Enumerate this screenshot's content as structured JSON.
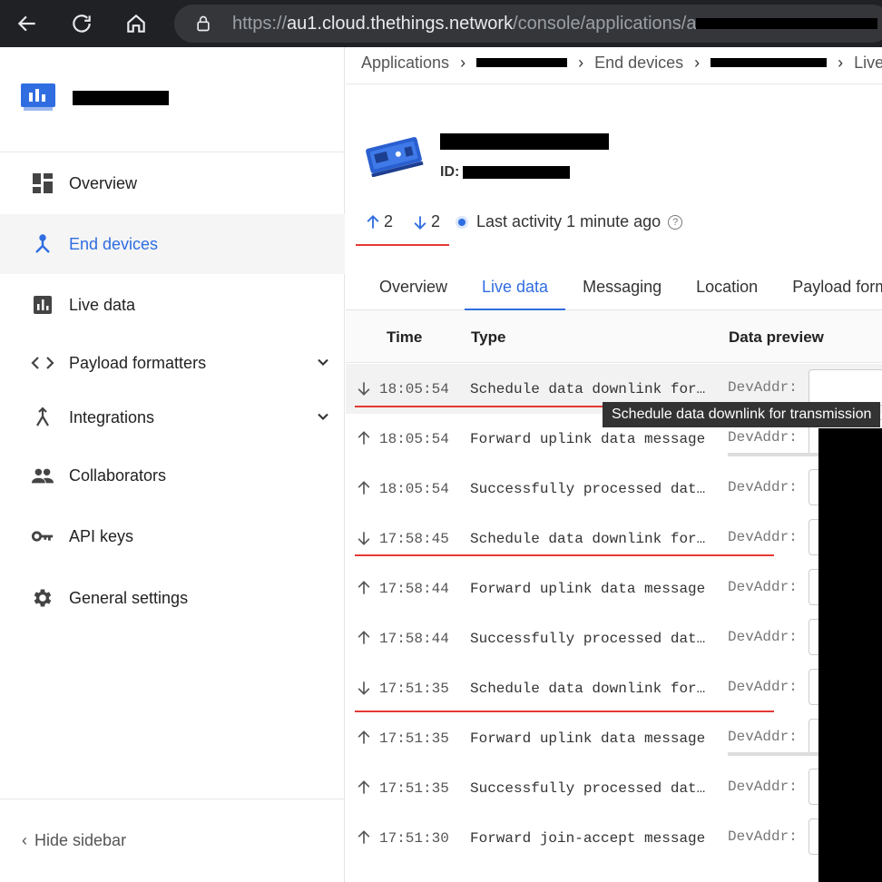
{
  "browser": {
    "url_host": "au1.cloud.thethings.network",
    "url_scheme": "https://",
    "url_path": "/console/applications/"
  },
  "sidebar": {
    "items": [
      {
        "label": "Overview",
        "icon": "dashboard-icon",
        "active": false
      },
      {
        "label": "End devices",
        "icon": "devices-icon",
        "active": true
      },
      {
        "label": "Live data",
        "icon": "chart-icon",
        "active": false
      },
      {
        "label": "Payload formatters",
        "icon": "code-icon",
        "active": false,
        "expandable": true
      },
      {
        "label": "Integrations",
        "icon": "merge-icon",
        "active": false,
        "expandable": true
      },
      {
        "label": "Collaborators",
        "icon": "people-icon",
        "active": false
      },
      {
        "label": "API keys",
        "icon": "key-icon",
        "active": false
      },
      {
        "label": "General settings",
        "icon": "gear-icon",
        "active": false
      }
    ],
    "hide_label": "Hide sidebar"
  },
  "breadcrumb": {
    "applications": "Applications",
    "end_devices": "End devices",
    "live": "Live d"
  },
  "device": {
    "id_label": "ID:"
  },
  "stats": {
    "up_count": "2",
    "down_count": "2",
    "activity": "Last activity 1 minute ago"
  },
  "tabs": [
    "Overview",
    "Live data",
    "Messaging",
    "Location",
    "Payload form"
  ],
  "table": {
    "headers": {
      "time": "Time",
      "type": "Type",
      "preview": "Data preview"
    },
    "rows": [
      {
        "dir": "down",
        "time": "18:05:54",
        "type": "Schedule data downlink for…",
        "dev": "DevAddr:"
      },
      {
        "dir": "up",
        "time": "18:05:54",
        "type": "Forward uplink data message",
        "dev": "DevAddr:"
      },
      {
        "dir": "up",
        "time": "18:05:54",
        "type": "Successfully processed dat…",
        "dev": "DevAddr:"
      },
      {
        "dir": "down",
        "time": "17:58:45",
        "type": "Schedule data downlink for…",
        "dev": "DevAddr:"
      },
      {
        "dir": "up",
        "time": "17:58:44",
        "type": "Forward uplink data message",
        "dev": "DevAddr:"
      },
      {
        "dir": "up",
        "time": "17:58:44",
        "type": "Successfully processed dat…",
        "dev": "DevAddr:"
      },
      {
        "dir": "down",
        "time": "17:51:35",
        "type": "Schedule data downlink for…",
        "dev": "DevAddr:"
      },
      {
        "dir": "up",
        "time": "17:51:35",
        "type": "Forward uplink data message",
        "dev": "DevAddr:"
      },
      {
        "dir": "up",
        "time": "17:51:35",
        "type": "Successfully processed dat…",
        "dev": "DevAddr:"
      },
      {
        "dir": "up",
        "time": "17:51:30",
        "type": "Forward join-accept message",
        "dev": "DevAddr:"
      }
    ]
  },
  "tooltip": "Schedule data downlink for transmission",
  "colors": {
    "accent": "#2f6de1",
    "annotation": "#e53935"
  }
}
